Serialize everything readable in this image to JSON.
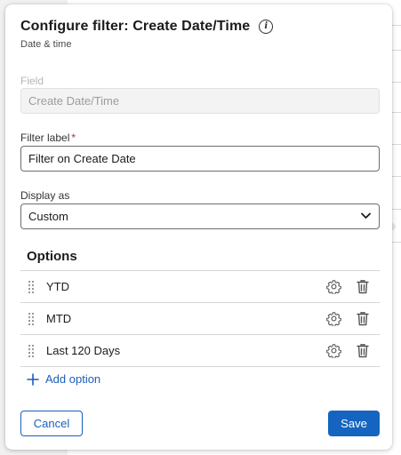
{
  "dialog": {
    "title": "Configure filter: Create Date/Time",
    "subtitle": "Date & time"
  },
  "field": {
    "label": "Field",
    "value": "Create Date/Time"
  },
  "filter_label": {
    "label": "Filter label",
    "required_mark": "*",
    "value": "Filter on Create Date"
  },
  "display_as": {
    "label": "Display as",
    "selected": "Custom"
  },
  "options": {
    "title": "Options",
    "items": [
      {
        "label": "YTD"
      },
      {
        "label": "MTD"
      },
      {
        "label": "Last 120 Days"
      }
    ],
    "add_label": "Add option"
  },
  "footer": {
    "cancel_label": "Cancel",
    "save_label": "Save"
  },
  "colors": {
    "accent": "#1565c0",
    "link": "#1c5fb8",
    "required": "#c4262e"
  },
  "icons": {
    "title_info": "info-icon",
    "select": "chevron-down-icon",
    "row_handle": "drag-handle-icon",
    "row_settings": "gear-icon",
    "row_delete": "trash-icon",
    "add": "plus-icon"
  }
}
